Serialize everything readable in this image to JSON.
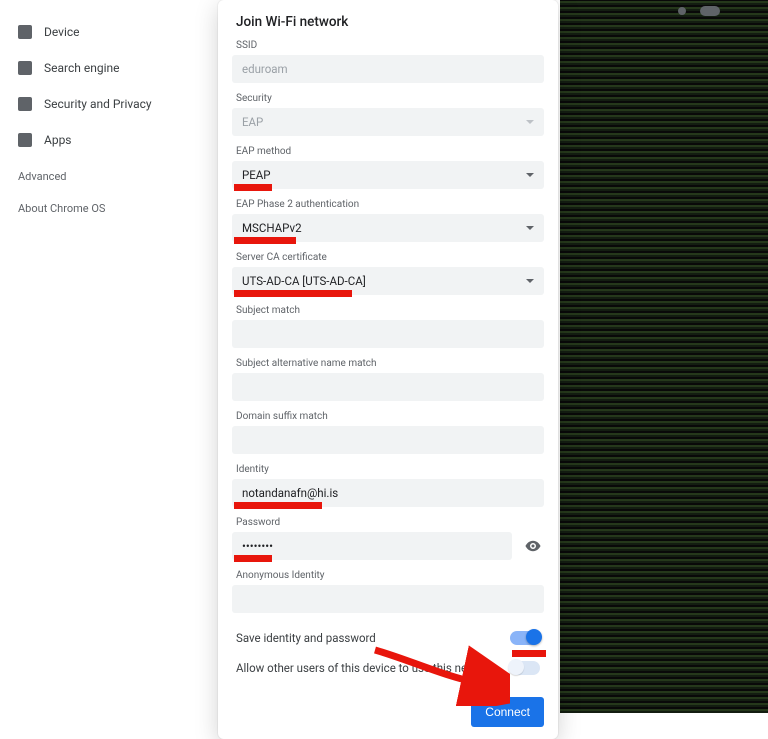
{
  "sidebar": {
    "items": [
      {
        "label": "Device"
      },
      {
        "label": "Search engine"
      },
      {
        "label": "Security and Privacy"
      },
      {
        "label": "Apps"
      }
    ],
    "sections": [
      {
        "label": "Advanced"
      },
      {
        "label": "About Chrome OS"
      }
    ]
  },
  "modal": {
    "title": "Join Wi-Fi network",
    "ssid_label": "SSID",
    "ssid_value": "eduroam",
    "security_label": "Security",
    "security_value": "EAP",
    "eap_method_label": "EAP method",
    "eap_method_value": "PEAP",
    "eap_phase2_label": "EAP Phase 2 authentication",
    "eap_phase2_value": "MSCHAPv2",
    "server_ca_label": "Server CA certificate",
    "server_ca_value": "UTS-AD-CA [UTS-AD-CA]",
    "subject_match_label": "Subject match",
    "subject_match_value": "",
    "san_match_label": "Subject alternative name match",
    "san_match_value": "",
    "domain_suffix_label": "Domain suffix match",
    "domain_suffix_value": "",
    "identity_label": "Identity",
    "identity_value": "notandanafn@hi.is",
    "password_label": "Password",
    "password_value": "••••••••",
    "anon_identity_label": "Anonymous Identity",
    "anon_identity_value": "",
    "save_toggle_label": "Save identity and password",
    "save_toggle_on": true,
    "share_toggle_label": "Allow other users of this device to use this network",
    "share_toggle_on": false,
    "connect_label": "Connect"
  }
}
